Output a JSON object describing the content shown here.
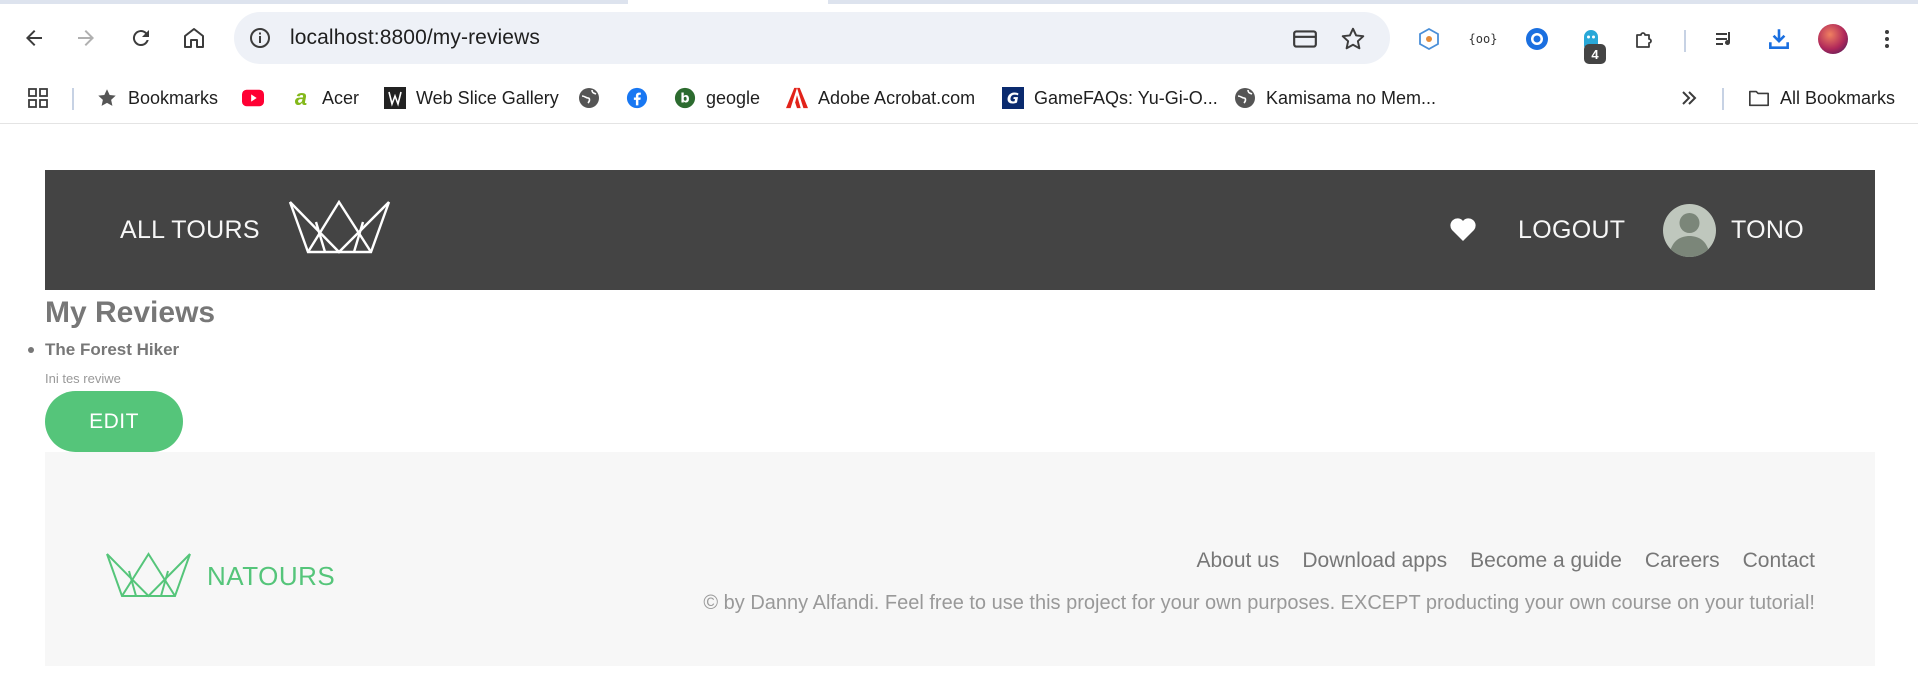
{
  "browser": {
    "url_host": "localhost",
    "url_path": ":8800/my-reviews",
    "extensions_badge": "4",
    "bookmarks": [
      {
        "label": "Bookmarks",
        "icon": "star-icon"
      },
      {
        "label": "",
        "icon": "youtube-icon"
      },
      {
        "label": "Acer",
        "icon": "acer-icon"
      },
      {
        "label": "Web Slice Gallery",
        "icon": "web-slice-icon"
      },
      {
        "label": "",
        "icon": "globe-icon"
      },
      {
        "label": "",
        "icon": "facebook-icon"
      },
      {
        "label": "geogle",
        "icon": "geogle-icon"
      },
      {
        "label": "Adobe Acrobat.com",
        "icon": "adobe-icon"
      },
      {
        "label": "GameFAQs: Yu-Gi-O...",
        "icon": "gamefaqs-icon"
      },
      {
        "label": "Kamisama no Mem...",
        "icon": "globe-icon"
      }
    ],
    "all_bookmarks_label": "All Bookmarks"
  },
  "header": {
    "all_tours": "ALL TOURS",
    "logout": "LOGOUT",
    "user_name": "TONO"
  },
  "main": {
    "title": "My Reviews",
    "reviews": [
      {
        "tour": "The Forest Hiker",
        "text": "Ini tes reviwe",
        "edit_label": "EDIT"
      }
    ]
  },
  "footer": {
    "brand": "NATOURS",
    "links": [
      "About us",
      "Download apps",
      "Become a guide",
      "Careers",
      "Contact"
    ],
    "copyright": "© by Danny Alfandi. Feel free to use this project for your own purposes. EXCEPT producting your own course on your tutorial!"
  },
  "colors": {
    "accent": "#55c57a",
    "header_bg": "#444444",
    "footer_bg": "#f7f7f7"
  }
}
